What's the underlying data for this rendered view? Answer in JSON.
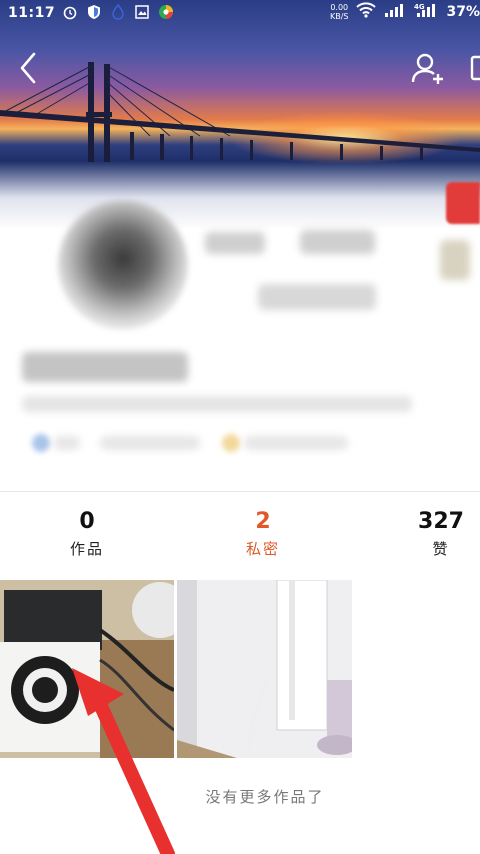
{
  "status_bar": {
    "time": "11:17",
    "net_speed_value": "0.00",
    "net_speed_unit": "KB/S",
    "battery": "37%"
  },
  "icons": {
    "back": "chevron-left-icon",
    "add_user": "add-user-icon",
    "more": "more-icon"
  },
  "stats": [
    {
      "value": "0",
      "label": "作品"
    },
    {
      "value": "2",
      "label": "私密"
    },
    {
      "value": "327",
      "label": "赞"
    }
  ],
  "active_tab_color": "#e0592b",
  "footer_text": "没有更多作品了"
}
